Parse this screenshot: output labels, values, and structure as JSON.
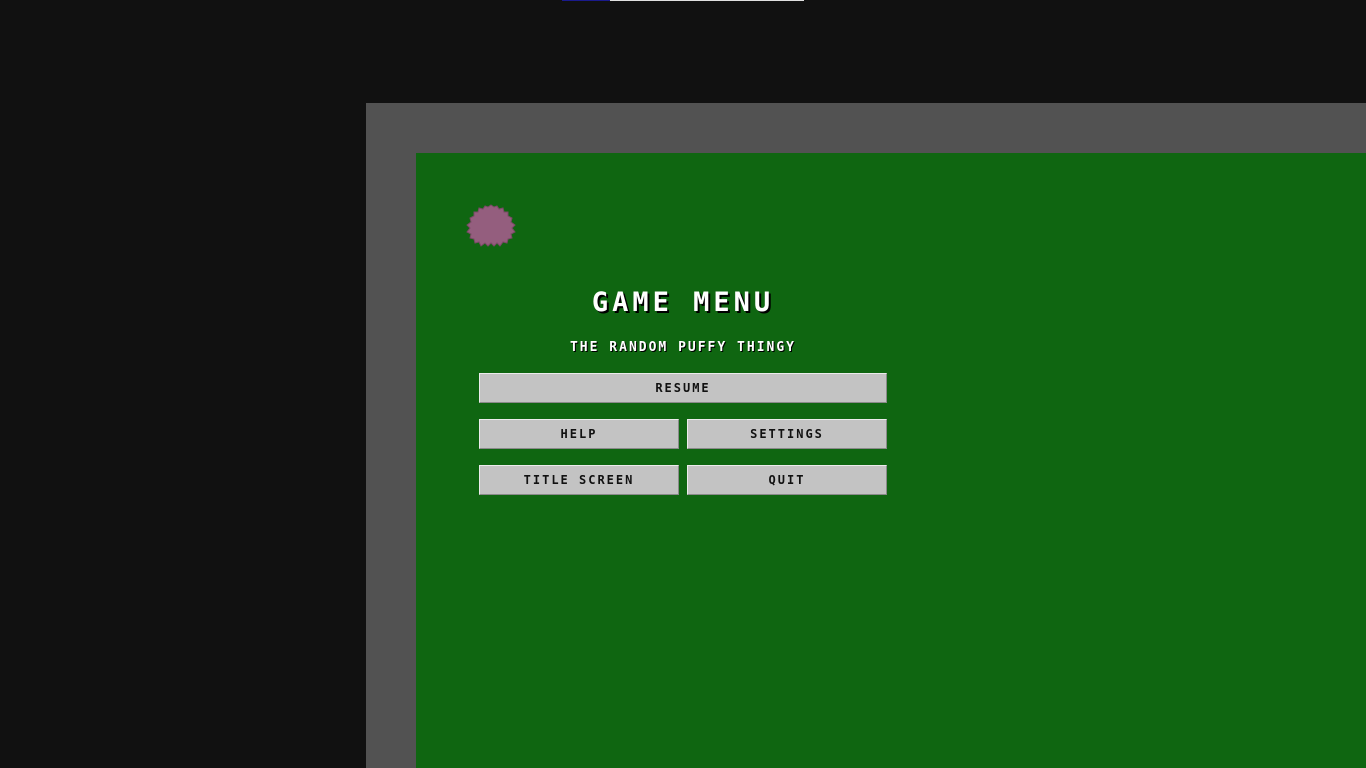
{
  "colors": {
    "background": "#111111",
    "frame": "#525252",
    "field": "#0f6611",
    "puffy": "#945e7e",
    "button": "#c3c3c3",
    "title_text": "#ffffff"
  },
  "menu": {
    "title": "GAME MENU",
    "subtitle": "THE RANDOM PUFFY THINGY",
    "buttons": {
      "resume": "RESUME",
      "help": "HELP",
      "settings": "SETTINGS",
      "title_screen": "TITLE SCREEN",
      "quit": "QUIT"
    }
  },
  "sprites": {
    "player": "puffy-creature-icon"
  }
}
